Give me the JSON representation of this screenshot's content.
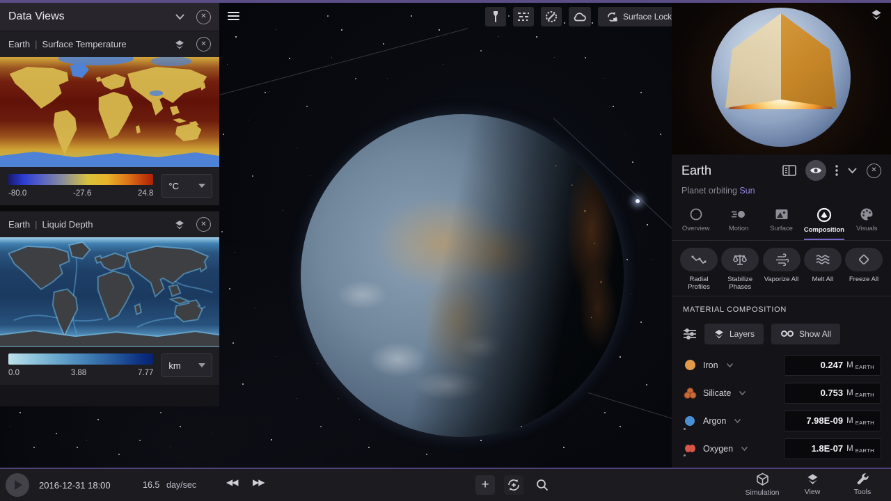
{
  "colors": {
    "accent_purple": "#5b4d86",
    "tab_underline": "#7568c9",
    "link_purple": "#9187e0",
    "iron": "#e09a4a",
    "silicate": "#c66a38",
    "argon": "#4a8fd4",
    "oxygen": "#d85548"
  },
  "icons": {
    "close": "✕",
    "plus": "+",
    "rewind": "◀◀",
    "fast_forward": "▶▶"
  },
  "left_panel": {
    "title": "Data Views",
    "views": [
      {
        "object": "Earth",
        "separator": "|",
        "field": "Surface Temperature",
        "scale_min": "-80.0",
        "scale_mid": "-27.6",
        "scale_max": "24.8",
        "unit": "°C"
      },
      {
        "object": "Earth",
        "separator": "|",
        "field": "Liquid Depth",
        "scale_min": "0.0",
        "scale_mid": "3.88",
        "scale_max": "7.77",
        "unit": "km"
      }
    ]
  },
  "viewport": {
    "surface_lock_label": "Surface Lock"
  },
  "right_panel": {
    "title": "Earth",
    "subtitle_prefix": "Planet orbiting ",
    "subtitle_link": "Sun",
    "active_tab": "Composition",
    "tabs": [
      {
        "label": "Overview"
      },
      {
        "label": "Motion"
      },
      {
        "label": "Surface"
      },
      {
        "label": "Composition"
      },
      {
        "label": "Visuals"
      }
    ],
    "actions": [
      {
        "label": "Radial Profiles"
      },
      {
        "label": "Stabilize Phases"
      },
      {
        "label": "Vaporize All"
      },
      {
        "label": "Melt All"
      },
      {
        "label": "Freeze All"
      }
    ],
    "section_title": "MATERIAL COMPOSITION",
    "layers_button": "Layers",
    "show_all_button": "Show All",
    "unit_main": "M",
    "unit_sub": "EARTH",
    "materials": [
      {
        "name": "Iron",
        "value": "0.247"
      },
      {
        "name": "Silicate",
        "value": "0.753"
      },
      {
        "name": "Argon",
        "value": "7.98E-09"
      },
      {
        "name": "Oxygen",
        "value": "1.8E-07"
      }
    ]
  },
  "bottom_bar": {
    "datetime": "2016-12-31 18:00",
    "speed_value": "16.5",
    "speed_unit": "day/sec",
    "menus": [
      {
        "label": "Simulation"
      },
      {
        "label": "View"
      },
      {
        "label": "Tools"
      }
    ]
  }
}
